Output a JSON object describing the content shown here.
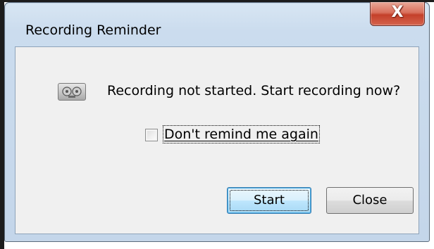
{
  "window": {
    "title": "Recording Reminder",
    "close_glyph": "X",
    "close_icon": "close-icon"
  },
  "message": {
    "icon": "tape-recorder-icon",
    "text": "Recording not started. Start recording now?"
  },
  "checkbox": {
    "label": "Don't remind me again",
    "checked": false
  },
  "buttons": {
    "start_label": "Start",
    "close_label": "Close"
  },
  "colors": {
    "close_button": "#c4402a",
    "default_button_border": "#3c7fb1",
    "title_bar": "#cbdcee",
    "client_background": "#f0f0f0"
  }
}
